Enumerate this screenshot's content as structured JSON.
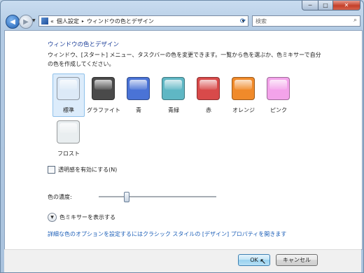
{
  "titlebar": {
    "min_icon": "minimize-icon",
    "max_icon": "maximize-icon",
    "close_icon": "close-icon",
    "min_glyph": "─",
    "max_glyph": "□",
    "close_glyph": "✕"
  },
  "nav": {
    "back_glyph": "◀",
    "forward_glyph": "▶",
    "dropdown_glyph": "▼"
  },
  "address": {
    "prefix": "«",
    "crumb1": "個人設定",
    "separator": "▸",
    "crumb2": "ウィンドウの色とデザイン",
    "dropdown_glyph": "▼",
    "refresh_glyph": "⟳"
  },
  "search": {
    "placeholder": "検索",
    "icon_glyph": "⌕"
  },
  "main": {
    "title": "ウィンドウの色とデザイン",
    "description_line1": "ウィンドウ、[スタート] メニュー、タスクバーの色を変更できます。一覧から色を選ぶか、色ミキサーで自分",
    "description_line2": "の色を作成してください。"
  },
  "swatches": [
    {
      "label": "標準",
      "color": "#dce9f7",
      "selected": true
    },
    {
      "label": "グラファイト",
      "color": "#4a4a4a",
      "selected": false
    },
    {
      "label": "青",
      "color": "#4a73d6",
      "selected": false
    },
    {
      "label": "青緑",
      "color": "#5fb7c4",
      "selected": false
    },
    {
      "label": "赤",
      "color": "#d84a4a",
      "selected": false
    },
    {
      "label": "オレンジ",
      "color": "#f08a2a",
      "selected": false
    },
    {
      "label": "ピンク",
      "color": "#f3a3ea",
      "selected": false
    },
    {
      "label": "フロスト",
      "color": "#e9eef0",
      "selected": false
    }
  ],
  "transparency": {
    "label": "透明感を有効にする(N)",
    "checked": false
  },
  "intensity": {
    "label": "色の濃度:",
    "value_fraction": 0.24
  },
  "mixer": {
    "label": "色ミキサーを表示する",
    "icon_glyph": "▼"
  },
  "link_text": "詳細な色のオプションを設定するにはクラシック スタイルの [デザイン] プロパティを開きます",
  "buttons": {
    "ok": "OK",
    "cancel": "キャンセル"
  },
  "cursor_glyph": "↖"
}
